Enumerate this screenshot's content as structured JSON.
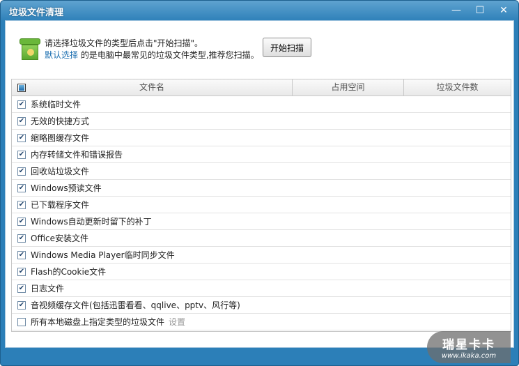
{
  "window": {
    "title": "垃圾文件清理",
    "minimize": "—",
    "maximize": "☐",
    "close": "✕"
  },
  "intro": {
    "line1": "请选择垃圾文件的类型后点击\"开始扫描\"。",
    "link": "默认选择",
    "line2": " 的是电脑中最常见的垃圾文件类型,推荐您扫描。",
    "icon": "recycle-bin-icon"
  },
  "scan_button": "开始扫描",
  "table": {
    "columns": [
      "文件名",
      "占用空间",
      "垃圾文件数"
    ],
    "rows": [
      {
        "name": "系统临时文件",
        "checked": true
      },
      {
        "name": "无效的快捷方式",
        "checked": true
      },
      {
        "name": "缩略图缓存文件",
        "checked": true
      },
      {
        "name": "内存转储文件和错误报告",
        "checked": true
      },
      {
        "name": "回收站垃圾文件",
        "checked": true
      },
      {
        "name": "Windows预读文件",
        "checked": true
      },
      {
        "name": "已下载程序文件",
        "checked": true
      },
      {
        "name": "Windows自动更新时留下的补丁",
        "checked": true
      },
      {
        "name": "Office安装文件",
        "checked": true
      },
      {
        "name": "Windows Media Player临时同步文件",
        "checked": true
      },
      {
        "name": "Flash的Cookie文件",
        "checked": true
      },
      {
        "name": "日志文件",
        "checked": true
      },
      {
        "name": "音视频缓存文件(包括迅雷看看、qqlive、pptv、风行等)",
        "checked": true
      },
      {
        "name": "所有本地磁盘上指定类型的垃圾文件",
        "checked": false,
        "extra": "设置"
      }
    ]
  },
  "watermark": {
    "brand": "瑞星卡卡",
    "url": "www.ikaka.com"
  }
}
